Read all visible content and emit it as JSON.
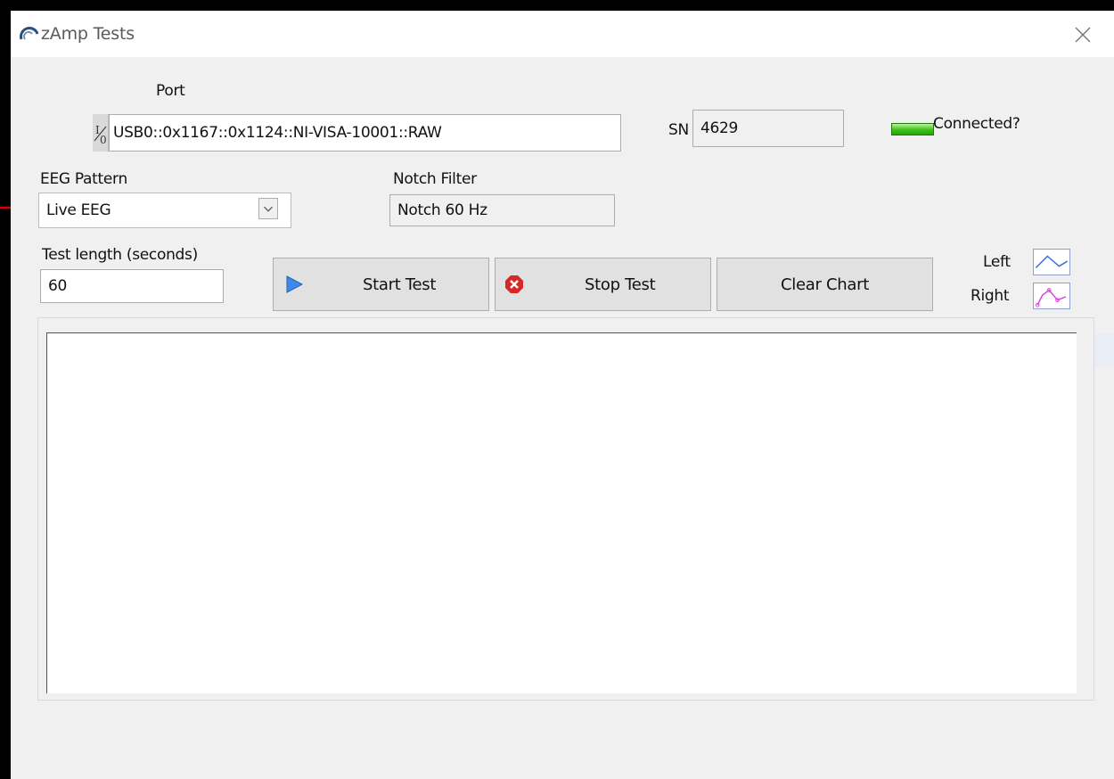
{
  "window": {
    "title": "zAmp Tests"
  },
  "port": {
    "label": "Port",
    "value": "USB0::0x1167::0x1124::NI-VISA-10001::RAW"
  },
  "serial": {
    "label": "SN",
    "value": "4629"
  },
  "connection": {
    "label": "Connected?",
    "led_color": "#3ec21a"
  },
  "eeg_pattern": {
    "label": "EEG Pattern",
    "selected": "Live EEG"
  },
  "notch_filter": {
    "label": "Notch Filter",
    "value": "Notch 60 Hz"
  },
  "test_length": {
    "label": "Test length (seconds)",
    "value": "60"
  },
  "buttons": {
    "start": "Start Test",
    "stop": "Stop Test",
    "clear": "Clear Chart"
  },
  "legend": {
    "left": {
      "label": "Left",
      "color": "#3b6fd6"
    },
    "right": {
      "label": "Right",
      "color": "#e040e0"
    }
  },
  "annotation": {
    "arrow_color": "#e00000"
  }
}
